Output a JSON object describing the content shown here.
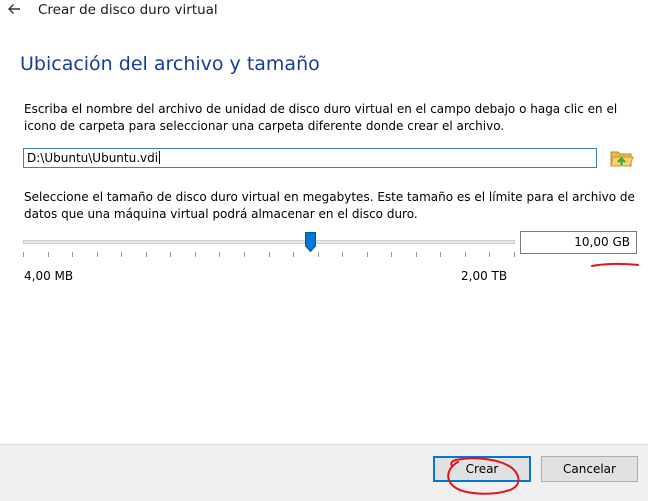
{
  "window": {
    "title": "Crear de disco duro virtual",
    "back_icon": "left-arrow-icon"
  },
  "page": {
    "heading": "Ubicación del archivo y tamaño",
    "location_description": "Escriba el nombre del archivo de unidad de disco duro virtual en el campo debajo o haga clic en el icono de carpeta para seleccionar una carpeta diferente donde crear el archivo.",
    "file_path": "D:\\Ubuntu\\Ubuntu.vdi",
    "folder_icon": "folder-open-icon",
    "size_description": "Seleccione el tamaño de disco duro virtual en megabytes. Este tamaño es el límite para el archivo de datos que una máquina virtual podrá almacenar en el disco duro."
  },
  "size_slider": {
    "min_label": "4,00 MB",
    "max_label": "2,00 TB",
    "position_fraction": 0.585,
    "tick_count": 21
  },
  "size_field": {
    "value": "10,00 GB"
  },
  "buttons": {
    "create_label": "Crear",
    "cancel_label": "Cancelar"
  },
  "colors": {
    "heading": "#163c9c",
    "slider_thumb": "#0078d7",
    "annotation": "#e0151b",
    "default_button_border": "#0078d7"
  }
}
